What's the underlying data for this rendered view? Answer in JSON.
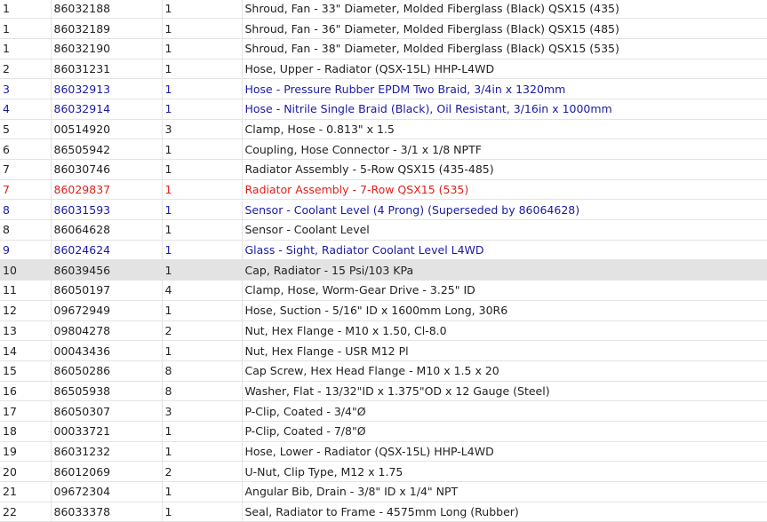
{
  "parts_table": {
    "rows": [
      {
        "ref": "1",
        "part": "86032188",
        "qty": "1",
        "desc": "Shroud, Fan - 33\" Diameter, Molded Fiberglass (Black) QSX15 (435)",
        "style": "normal"
      },
      {
        "ref": "1",
        "part": "86032189",
        "qty": "1",
        "desc": "Shroud, Fan - 36\" Diameter, Molded Fiberglass (Black) QSX15 (485)",
        "style": "normal"
      },
      {
        "ref": "1",
        "part": "86032190",
        "qty": "1",
        "desc": "Shroud, Fan - 38\" Diameter, Molded Fiberglass (Black) QSX15 (535)",
        "style": "normal"
      },
      {
        "ref": "2",
        "part": "86031231",
        "qty": "1",
        "desc": "Hose, Upper - Radiator (QSX-15L) HHP-L4WD",
        "style": "normal"
      },
      {
        "ref": "3",
        "part": "86032913",
        "qty": "1",
        "desc": "Hose - Pressure Rubber EPDM Two Braid, 3/4in x 1320mm",
        "style": "blue"
      },
      {
        "ref": "4",
        "part": "86032914",
        "qty": "1",
        "desc": "Hose - Nitrile Single Braid (Black), Oil Resistant, 3/16in x 1000mm",
        "style": "blue"
      },
      {
        "ref": "5",
        "part": "00514920",
        "qty": "3",
        "desc": "Clamp, Hose - 0.813\" x 1.5",
        "style": "normal"
      },
      {
        "ref": "6",
        "part": "86505942",
        "qty": "1",
        "desc": "Coupling, Hose Connector - 3/1 x 1/8 NPTF",
        "style": "normal"
      },
      {
        "ref": "7",
        "part": "86030746",
        "qty": "1",
        "desc": "Radiator Assembly - 5-Row QSX15 (435-485)",
        "style": "normal"
      },
      {
        "ref": "7",
        "part": "86029837",
        "qty": "1",
        "desc": "Radiator Assembly - 7-Row QSX15 (535)",
        "style": "red"
      },
      {
        "ref": "8",
        "part": "86031593",
        "qty": "1",
        "desc": "Sensor - Coolant Level (4 Prong) (Superseded by 86064628)",
        "style": "blue"
      },
      {
        "ref": "8",
        "part": "86064628",
        "qty": "1",
        "desc": "Sensor - Coolant Level",
        "style": "normal"
      },
      {
        "ref": "9",
        "part": "86024624",
        "qty": "1",
        "desc": "Glass - Sight, Radiator Coolant Level L4WD",
        "style": "blue"
      },
      {
        "ref": "10",
        "part": "86039456",
        "qty": "1",
        "desc": "Cap, Radiator - 15 Psi/103 KPa",
        "style": "highlight"
      },
      {
        "ref": "11",
        "part": "86050197",
        "qty": "4",
        "desc": "Clamp, Hose, Worm-Gear Drive - 3.25\" ID",
        "style": "normal"
      },
      {
        "ref": "12",
        "part": "09672949",
        "qty": "1",
        "desc": "Hose, Suction - 5/16\" ID x 1600mm Long, 30R6",
        "style": "normal"
      },
      {
        "ref": "13",
        "part": "09804278",
        "qty": "2",
        "desc": "Nut, Hex Flange - M10 x 1.50, Cl-8.0",
        "style": "normal"
      },
      {
        "ref": "14",
        "part": "00043436",
        "qty": "1",
        "desc": "Nut, Hex Flange - USR M12 Pl",
        "style": "normal"
      },
      {
        "ref": "15",
        "part": "86050286",
        "qty": "8",
        "desc": "Cap Screw, Hex Head Flange - M10 x 1.5 x 20",
        "style": "normal"
      },
      {
        "ref": "16",
        "part": "86505938",
        "qty": "8",
        "desc": "Washer, Flat - 13/32\"ID x 1.375\"OD x 12 Gauge (Steel)",
        "style": "normal"
      },
      {
        "ref": "17",
        "part": "86050307",
        "qty": "3",
        "desc": "P-Clip, Coated - 3/4\"Ø",
        "style": "normal"
      },
      {
        "ref": "18",
        "part": "00033721",
        "qty": "1",
        "desc": "P-Clip, Coated - 7/8\"Ø",
        "style": "normal"
      },
      {
        "ref": "19",
        "part": "86031232",
        "qty": "1",
        "desc": "Hose, Lower - Radiator (QSX-15L) HHP-L4WD",
        "style": "normal"
      },
      {
        "ref": "20",
        "part": "86012069",
        "qty": "2",
        "desc": "U-Nut, Clip Type, M12 x 1.75",
        "style": "normal"
      },
      {
        "ref": "21",
        "part": "09672304",
        "qty": "1",
        "desc": "Angular Bib, Drain - 3/8\" ID x 1/4\" NPT",
        "style": "normal"
      },
      {
        "ref": "22",
        "part": "86033378",
        "qty": "1",
        "desc": "Seal, Radiator to Frame - 4575mm Long (Rubber)",
        "style": "normal"
      }
    ]
  }
}
